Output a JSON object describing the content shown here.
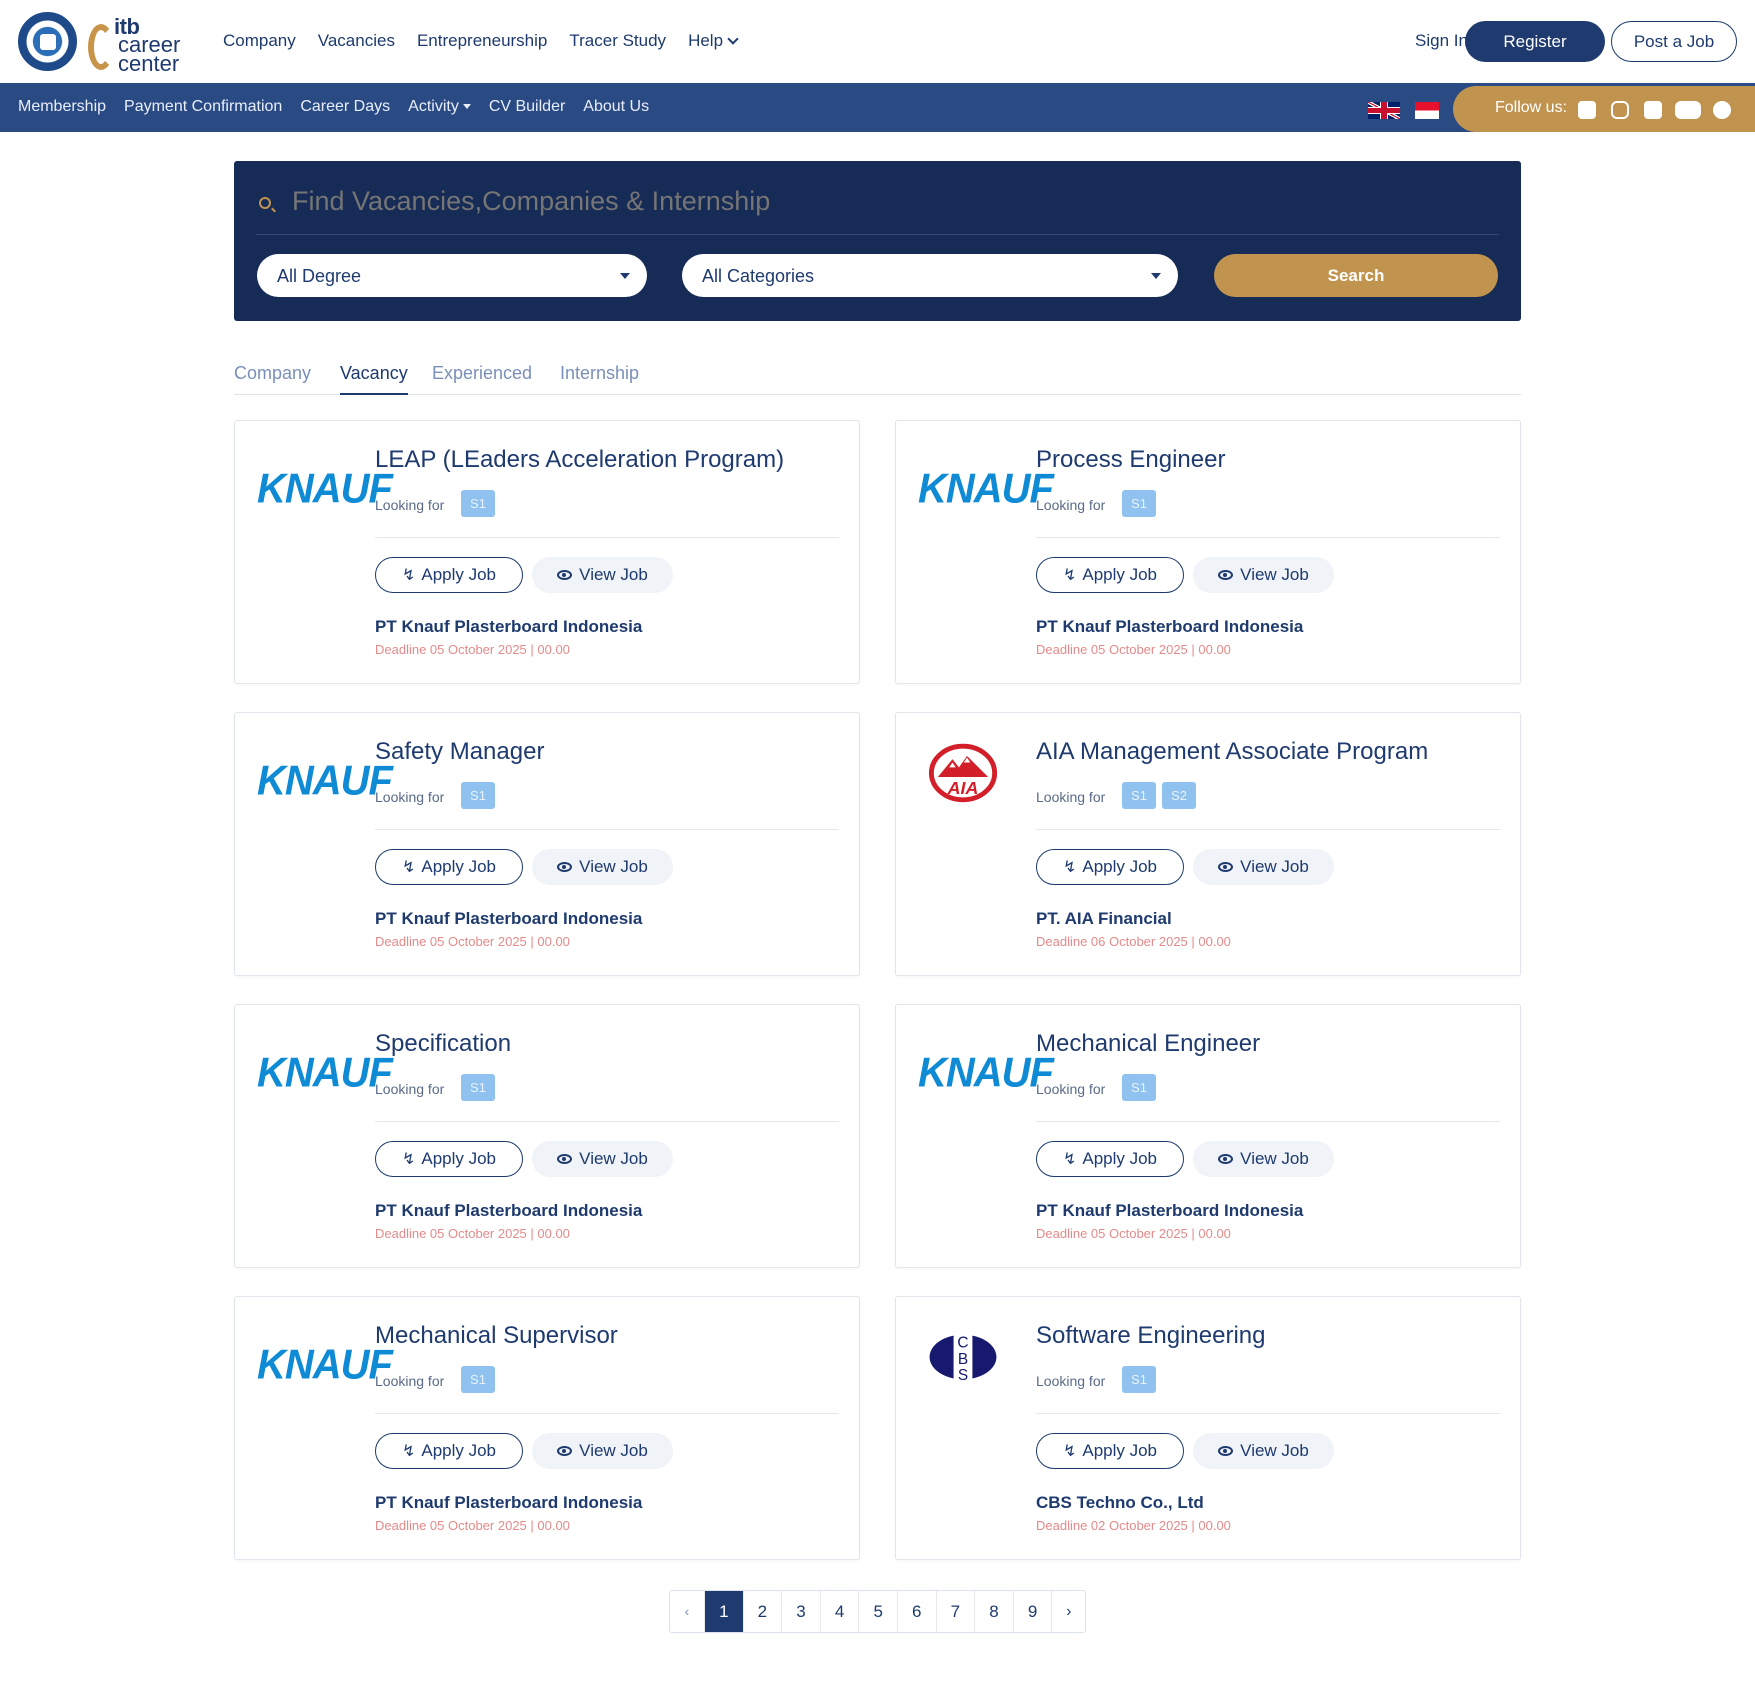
{
  "header": {
    "nav": [
      "Company",
      "Vacancies",
      "Entrepreneurship",
      "Tracer Study",
      "Help"
    ],
    "sign_in": "Sign In",
    "register": "Register",
    "post_job": "Post a Job"
  },
  "logo": {
    "line1": "itb",
    "line2": "career",
    "line3": "center"
  },
  "subnav": {
    "items": [
      "Membership",
      "Payment Confirmation",
      "Career Days",
      "Activity",
      "CV Builder",
      "About Us"
    ],
    "follow_label": "Follow us:",
    "social_icons": [
      "facebook-icon",
      "instagram-icon",
      "x-icon",
      "youtube-icon",
      "line-icon"
    ]
  },
  "search": {
    "placeholder": "Find Vacancies,Companies & Internship",
    "degree": "All Degree",
    "category": "All Categories",
    "button": "Search"
  },
  "tabs": [
    "Company",
    "Vacancy",
    "Experienced",
    "Internship"
  ],
  "active_tab": "Vacancy",
  "looking_for_label": "Looking for",
  "apply_label": "Apply Job",
  "view_label": "View Job",
  "jobs": [
    {
      "title": "LEAP (LEaders Acceleration Program)",
      "logo": "KNAUF",
      "degrees": [
        "S1"
      ],
      "company": "PT Knauf Plasterboard Indonesia",
      "deadline": "Deadline 05 October 2025 | 00.00"
    },
    {
      "title": "Process Engineer",
      "logo": "KNAUF",
      "degrees": [
        "S1"
      ],
      "company": "PT Knauf Plasterboard Indonesia",
      "deadline": "Deadline 05 October 2025 | 00.00"
    },
    {
      "title": "Safety Manager",
      "logo": "KNAUF",
      "degrees": [
        "S1"
      ],
      "company": "PT Knauf Plasterboard Indonesia",
      "deadline": "Deadline 05 October 2025 | 00.00"
    },
    {
      "title": "AIA Management Associate Program",
      "logo": "AIA",
      "degrees": [
        "S1",
        "S2"
      ],
      "company": "PT. AIA Financial",
      "deadline": "Deadline 06 October 2025 | 00.00"
    },
    {
      "title": "Specification",
      "logo": "KNAUF",
      "degrees": [
        "S1"
      ],
      "company": "PT Knauf Plasterboard Indonesia",
      "deadline": "Deadline 05 October 2025 | 00.00"
    },
    {
      "title": "Mechanical Engineer",
      "logo": "KNAUF",
      "degrees": [
        "S1"
      ],
      "company": "PT Knauf Plasterboard Indonesia",
      "deadline": "Deadline 05 October 2025 | 00.00"
    },
    {
      "title": "Mechanical Supervisor",
      "logo": "KNAUF",
      "degrees": [
        "S1"
      ],
      "company": "PT Knauf Plasterboard Indonesia",
      "deadline": "Deadline 05 October 2025 | 00.00"
    },
    {
      "title": "Software Engineering",
      "logo": "CBS",
      "degrees": [
        "S1"
      ],
      "company": "CBS Techno Co., Ltd",
      "deadline": "Deadline 02 October 2025 | 00.00"
    }
  ],
  "pagination": {
    "prev": "‹",
    "next": "›",
    "pages": [
      "1",
      "2",
      "3",
      "4",
      "5",
      "6",
      "7",
      "8",
      "9"
    ],
    "current": "1"
  },
  "colors": {
    "navy": "#1e3a6e",
    "gold": "#c0944f",
    "badge": "#8fc2ee",
    "deadline": "#e48a8a"
  }
}
